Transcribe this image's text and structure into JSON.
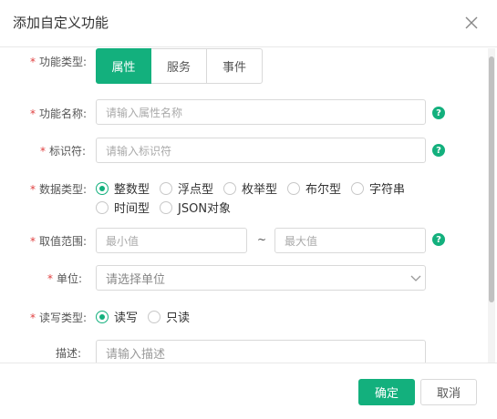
{
  "dialog": {
    "title": "添加自定义功能"
  },
  "form": {
    "feature_type": {
      "label": "功能类型:",
      "tabs": [
        "属性",
        "服务",
        "事件"
      ],
      "active_index": 0
    },
    "feature_name": {
      "label": "功能名称:",
      "placeholder": "请输入属性名称"
    },
    "identifier": {
      "label": "标识符:",
      "placeholder": "请输入标识符"
    },
    "data_type": {
      "label": "数据类型:",
      "options": [
        "整数型",
        "浮点型",
        "枚举型",
        "布尔型",
        "字符串",
        "时间型",
        "JSON对象"
      ],
      "selected": "整数型"
    },
    "value_range": {
      "label": "取值范围:",
      "min_placeholder": "最小值",
      "separator": "~",
      "max_placeholder": "最大值"
    },
    "unit": {
      "label": "单位:",
      "placeholder": "请选择单位"
    },
    "rw_type": {
      "label": "读写类型:",
      "options": [
        "读写",
        "只读"
      ],
      "selected": "读写"
    },
    "description": {
      "label": "描述:",
      "placeholder": "请输入描述"
    },
    "required_mark": "*",
    "help_glyph": "?"
  },
  "footer": {
    "confirm_label": "确定",
    "cancel_label": "取消"
  },
  "colors": {
    "accent": "#13b07d",
    "required": "#e04040"
  },
  "icons": {
    "close": "close-icon",
    "help": "help-circle-icon",
    "select": "chevron-down-icon"
  }
}
